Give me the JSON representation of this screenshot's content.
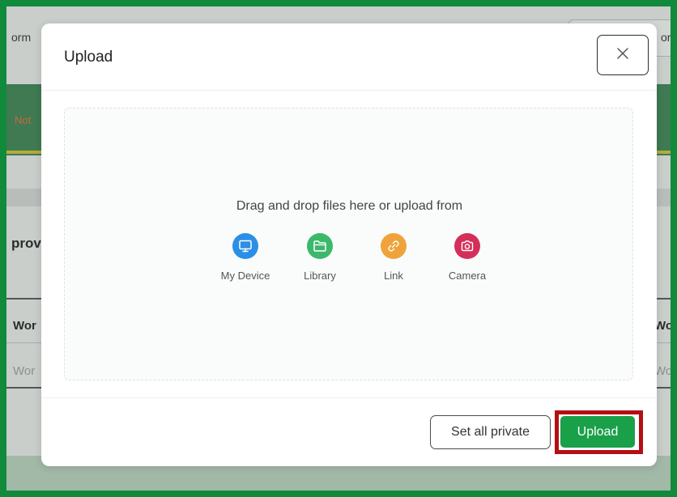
{
  "background": {
    "top_left_text": "orm",
    "top_right_text": "or",
    "status_text": "Not",
    "section_fragment": "prov",
    "col_header_left": "Wor",
    "col_header_right": "Wo",
    "placeholder_left": "Wor",
    "placeholder_right": "Wo"
  },
  "modal": {
    "title": "Upload",
    "close_icon": "close-icon",
    "dropzone_text": "Drag and drop files here or upload from",
    "sources": [
      {
        "label": "My Device",
        "icon": "monitor-icon",
        "color": "#2b8fe6"
      },
      {
        "label": "Library",
        "icon": "folder-icon",
        "color": "#3db86b"
      },
      {
        "label": "Link",
        "icon": "link-icon",
        "color": "#f0a33a"
      },
      {
        "label": "Camera",
        "icon": "camera-icon",
        "color": "#d42f5a"
      }
    ],
    "set_private_label": "Set all private",
    "upload_label": "Upload"
  },
  "colors": {
    "frame": "#118a3c",
    "upload_button": "#1aa049",
    "highlight": "#b30f14"
  }
}
